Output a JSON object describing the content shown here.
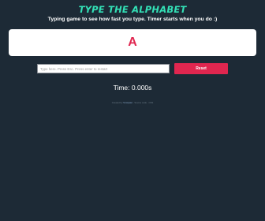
{
  "header": {
    "title": "Type The Alphabet",
    "subtitle": "Typing game to see how fast you type. Timer starts when you do :)"
  },
  "game": {
    "current_letter": "A",
    "input_placeholder": "Type here. Press Esc. Press enter to restart",
    "input_value": "",
    "reset_label": "Reset",
    "timer_text": "Time: 0.000s"
  },
  "footer": {
    "prefix": "Created by",
    "author": "Smitpatel",
    "suffix": "· Source code · CSS"
  },
  "colors": {
    "background": "#1d2a36",
    "title_accent": "#33e0b6",
    "letter_accent": "#e0264f",
    "button": "#e0264f"
  }
}
